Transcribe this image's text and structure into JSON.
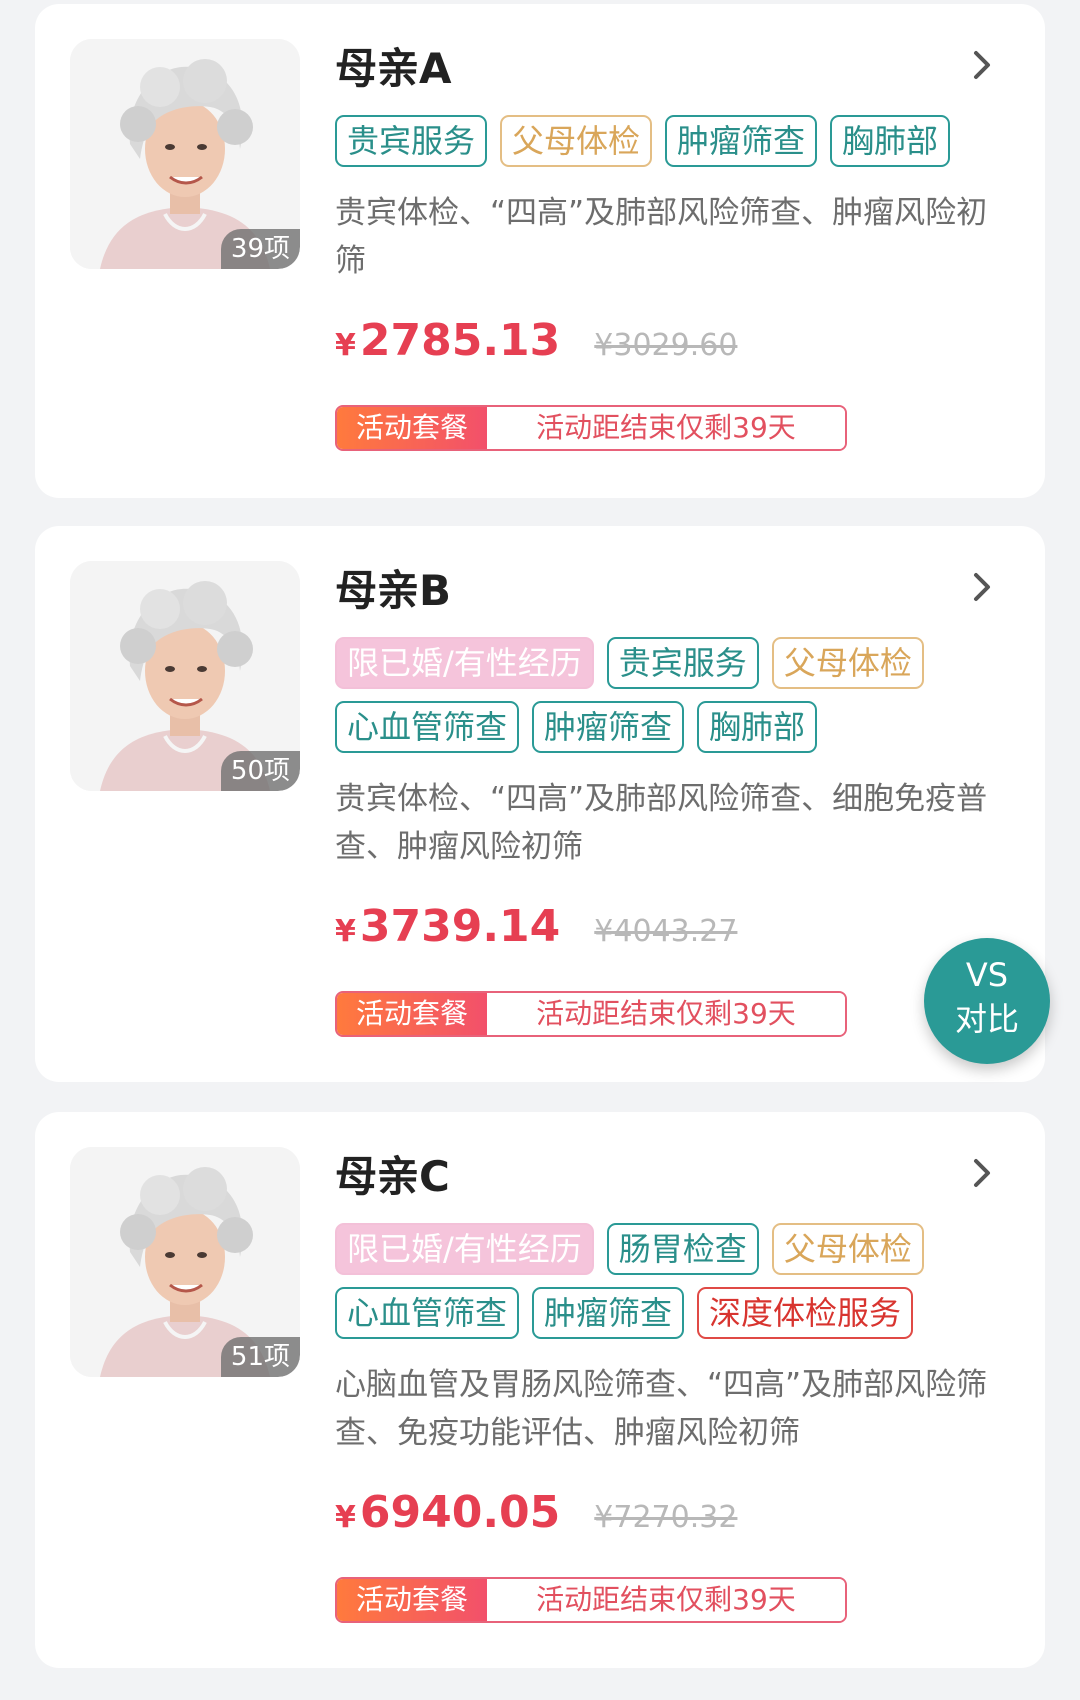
{
  "packages": [
    {
      "title": "母亲A",
      "item_count": "39项",
      "tags": [
        {
          "label": "贵宾服务",
          "style": "teal"
        },
        {
          "label": "父母体检",
          "style": "gold"
        },
        {
          "label": "肿瘤筛查",
          "style": "teal"
        },
        {
          "label": "胸肺部",
          "style": "teal"
        }
      ],
      "description": "贵宾体检、“四高”及肺部风险筛查、肿瘤风险初筛",
      "price_symbol": "¥",
      "price": "2785.13",
      "original_price": "¥3029.60",
      "promo_label": "活动套餐",
      "promo_text": "活动距结束仅剩39天"
    },
    {
      "title": "母亲B",
      "item_count": "50项",
      "tags": [
        {
          "label": "限已婚/有性经历",
          "style": "pink"
        },
        {
          "label": "贵宾服务",
          "style": "teal"
        },
        {
          "label": "父母体检",
          "style": "gold"
        },
        {
          "label": "心血管筛查",
          "style": "teal"
        },
        {
          "label": "肿瘤筛查",
          "style": "teal"
        },
        {
          "label": "胸肺部",
          "style": "teal"
        }
      ],
      "description": "贵宾体检、“四高”及肺部风险筛查、细胞免疫普查、肿瘤风险初筛",
      "price_symbol": "¥",
      "price": "3739.14",
      "original_price": "¥4043.27",
      "promo_label": "活动套餐",
      "promo_text": "活动距结束仅剩39天"
    },
    {
      "title": "母亲C",
      "item_count": "51项",
      "tags": [
        {
          "label": "限已婚/有性经历",
          "style": "pink"
        },
        {
          "label": "肠胃检查",
          "style": "teal"
        },
        {
          "label": "父母体检",
          "style": "gold"
        },
        {
          "label": "心血管筛查",
          "style": "teal"
        },
        {
          "label": "肿瘤筛查",
          "style": "teal"
        },
        {
          "label": "深度体检服务",
          "style": "red"
        }
      ],
      "description": "心脑血管及胃肠风险筛查、“四高”及肺部风险筛查、免疫功能评估、肿瘤风险初筛",
      "price_symbol": "¥",
      "price": "6940.05",
      "original_price": "¥7270.32",
      "promo_label": "活动套餐",
      "promo_text": "活动距结束仅剩39天"
    }
  ],
  "compare_button": {
    "line1": "VS",
    "line2": "对比"
  },
  "colors": {
    "accent_teal": "#2a9a96",
    "price_red": "#e63f52",
    "gold": "#d9a65a",
    "pink": "#f5c4db",
    "deep_red": "#d8342f"
  },
  "icons": {
    "chevron": "chevron-right-icon"
  }
}
